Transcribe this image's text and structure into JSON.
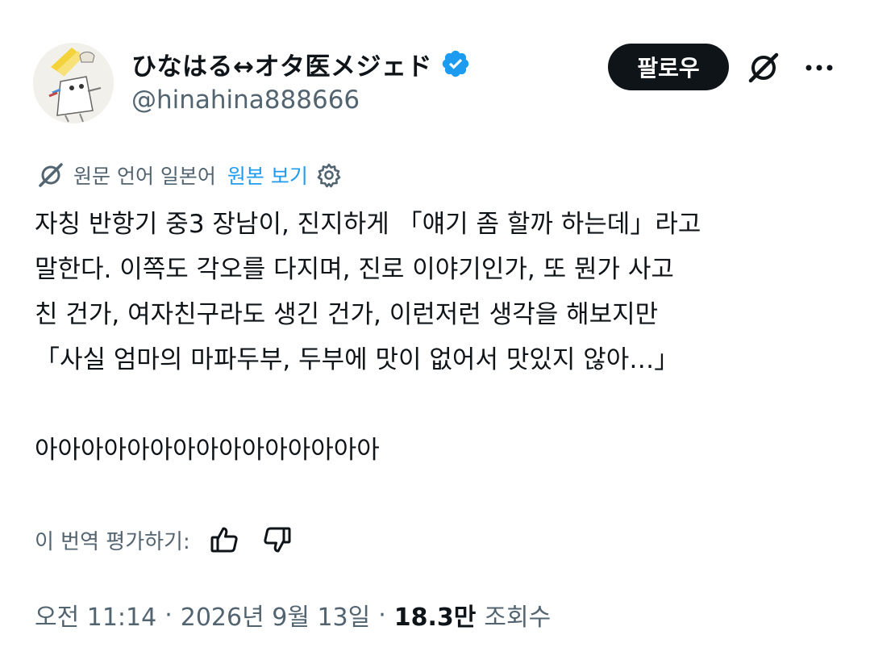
{
  "header": {
    "display_name": "ひなはる↔オタ医メジェド",
    "handle": "@hinahina888666",
    "follow_label": "팔로우",
    "verified_icon": "verified-badge-icon",
    "grok_icon": "grok-icon",
    "more_icon": "more-options-icon",
    "verified_color": "#1d9bf0"
  },
  "translation": {
    "source_language_label": "원문 언어 일본어",
    "show_original_label": "원본 보기",
    "translate_icon": "grok-icon",
    "settings_icon": "gear-icon",
    "link_color": "#1d9bf0"
  },
  "tweet": {
    "lines": [
      "자칭 반항기 중3 장남이, 진지하게 「얘기 좀 할까 하는데」라고",
      "말한다. 이쪽도 각오를 다지며, 진로 이야기인가, 또 뭔가 사고",
      "친 건가, 여자친구라도 생긴 건가, 이런저런 생각을 해보지만",
      "「사실 엄마의 마파두부, 두부에 맛이 없어서 맛있지 않아…」"
    ],
    "last_line": "아아아아아아아아아아아아아아아"
  },
  "rating": {
    "label": "이 번역 평가하기:",
    "thumbs_up_icon": "thumbs-up-icon",
    "thumbs_down_icon": "thumbs-down-icon"
  },
  "meta": {
    "time": "오전 11:14",
    "separator": "·",
    "date": "2026년 9월 13일",
    "views_count": "18.3만",
    "views_label": "조회수"
  }
}
